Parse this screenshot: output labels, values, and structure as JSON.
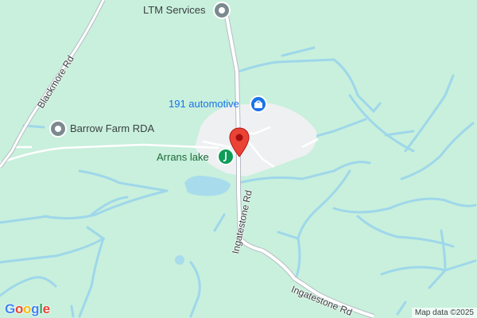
{
  "colors": {
    "land": "#c8f0dc",
    "water": "#a8dcec",
    "water_stroke": "#9fd7ea",
    "road": "#ffffff",
    "road_major": "#b7bcc4",
    "urban": "#eef0f2",
    "marker_red": "#ea4335",
    "poi_grey": "#7b8a8f",
    "poi_blue": "#1a73e8",
    "poi_green": "#0f9d58"
  },
  "pois": {
    "ltm_services": {
      "label": "LTM Services",
      "icon": "service-icon"
    },
    "automotive": {
      "label": "191 automotive",
      "icon": "car-shop-icon"
    },
    "barrow_farm": {
      "label": "Barrow Farm RDA",
      "icon": "service-icon"
    },
    "arrans_lake": {
      "label": "Arrans lake",
      "icon": "fishing-icon"
    }
  },
  "roads": {
    "blackmore": "Blackmore Rd",
    "ingatestone_vertical": "Ingatestone Rd",
    "ingatestone_diagonal": "Ingatestone Rd"
  },
  "marker": {
    "icon": "map-pin-icon"
  },
  "branding": {
    "logo": "Google",
    "attribution": "Map data ©2025"
  }
}
